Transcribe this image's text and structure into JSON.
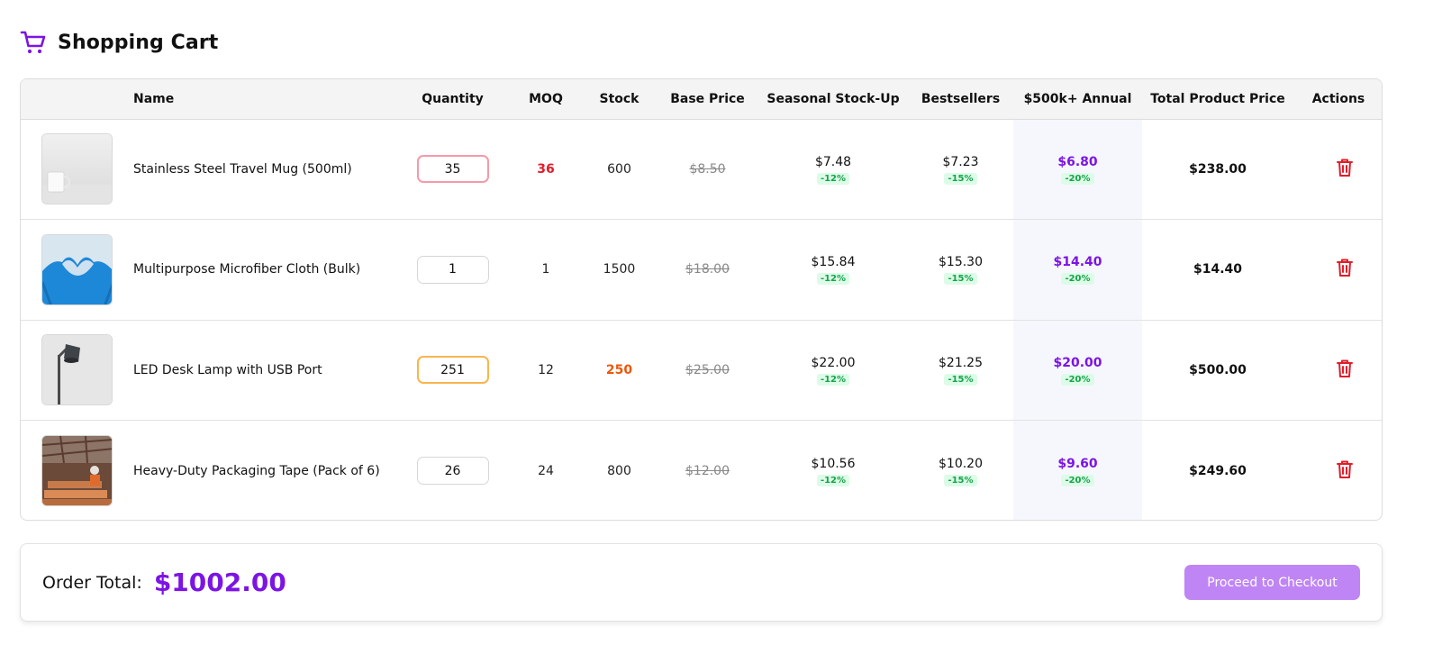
{
  "header": {
    "title": "Shopping Cart",
    "icon": "shopping-cart-icon",
    "icon_color": "#7c14e4"
  },
  "table": {
    "columns": [
      "",
      "Name",
      "Quantity",
      "MOQ",
      "Stock",
      "Base Price",
      "Seasonal Stock-Up",
      "Bestsellers",
      "$500k+ Annual",
      "Total Product Price",
      "Actions"
    ],
    "rows": [
      {
        "image": "white-mug-photo",
        "name": "Stainless Steel Travel Mug (500ml)",
        "quantity": "35",
        "qty_state": "warn-red",
        "moq": "36",
        "moq_state": "red",
        "stock": "600",
        "stock_state": "",
        "base_price": "$8.50",
        "seasonal": "$7.48",
        "seasonal_pct": "-12%",
        "bestsellers": "$7.23",
        "bestsellers_pct": "-15%",
        "annual": "$6.80",
        "annual_pct": "-20%",
        "total": "$238.00"
      },
      {
        "image": "blue-gloves-heart-photo",
        "name": "Multipurpose Microfiber Cloth (Bulk)",
        "quantity": "1",
        "qty_state": "",
        "moq": "1",
        "moq_state": "",
        "stock": "1500",
        "stock_state": "",
        "base_price": "$18.00",
        "seasonal": "$15.84",
        "seasonal_pct": "-12%",
        "bestsellers": "$15.30",
        "bestsellers_pct": "-15%",
        "annual": "$14.40",
        "annual_pct": "-20%",
        "total": "$14.40"
      },
      {
        "image": "desk-lamp-photo",
        "name": "LED Desk Lamp with USB Port",
        "quantity": "251",
        "qty_state": "warn-orange",
        "moq": "12",
        "moq_state": "",
        "stock": "250",
        "stock_state": "orange",
        "base_price": "$25.00",
        "seasonal": "$22.00",
        "seasonal_pct": "-12%",
        "bestsellers": "$21.25",
        "bestsellers_pct": "-15%",
        "annual": "$20.00",
        "annual_pct": "-20%",
        "total": "$500.00"
      },
      {
        "image": "construction-site-photo",
        "name": "Heavy-Duty Packaging Tape (Pack of 6)",
        "quantity": "26",
        "qty_state": "",
        "moq": "24",
        "moq_state": "",
        "stock": "800",
        "stock_state": "",
        "base_price": "$12.00",
        "seasonal": "$10.56",
        "seasonal_pct": "-12%",
        "bestsellers": "$10.20",
        "bestsellers_pct": "-15%",
        "annual": "$9.60",
        "annual_pct": "-20%",
        "total": "$249.60"
      }
    ]
  },
  "footer": {
    "label": "Order Total:",
    "amount": "$1002.00",
    "checkout_label": "Proceed to Checkout"
  },
  "colors": {
    "accent": "#7c14e4",
    "checkout_bg": "#bf85f5",
    "danger": "#e11d2a",
    "warning": "#ea580c",
    "discount_green": "#16a34a"
  }
}
